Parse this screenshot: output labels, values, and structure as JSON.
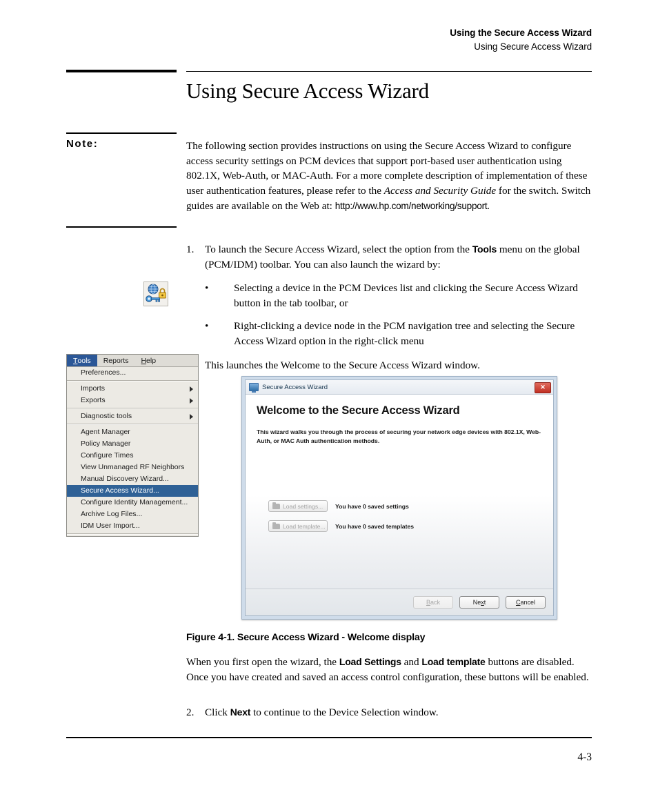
{
  "running_header": {
    "line1": "Using the Secure Access Wizard",
    "line2": "Using Secure Access Wizard"
  },
  "page_title": "Using Secure Access Wizard",
  "note": {
    "label": "Note:",
    "text_part1": "The following section provides instructions on using the Secure Access Wizard to configure access security settings on PCM devices that support port-based user authentication using 802.1X, Web-Auth, or MAC-Auth. For a more complete description of implementation of these user authentication features, please refer to the ",
    "italic_title": "Access and Security Guide",
    "text_part2": " for the switch. Switch guides are available on the Web at: ",
    "url": "http://www.hp.com/networking/support."
  },
  "steps": {
    "step1": {
      "number": "1.",
      "text_a": "To launch the Secure Access Wizard, select the option from the ",
      "bold_a": "Tools",
      "text_b": " menu on the global (PCM/IDM) toolbar. You can also launch the wizard by:",
      "bullets": [
        "Selecting a device in the PCM Devices list and clicking the Secure Access Wizard button in the tab toolbar, or",
        "Right-clicking a device node in the PCM navigation tree and selecting the Secure Access Wizard option in the right-click menu"
      ],
      "closing": "This launches the Welcome to the Secure Access Wizard window."
    },
    "step2": {
      "number": "2.",
      "text_a": "Click ",
      "bold_a": "Next",
      "text_b": " to continue to the Device Selection window."
    }
  },
  "margin_icon": "secure-access-wizard-toolbar-icon",
  "tools_menu": {
    "menubar": [
      {
        "label": "Tools",
        "mnemonic": "T",
        "active": true
      },
      {
        "label": "Reports",
        "mnemonic": "",
        "active": false
      },
      {
        "label": "Help",
        "mnemonic": "H",
        "active": false
      }
    ],
    "items": [
      {
        "label": "Preferences...",
        "submenu": false,
        "selected": false,
        "sep_after": true
      },
      {
        "label": "Imports",
        "submenu": true,
        "selected": false,
        "sep_after": false
      },
      {
        "label": "Exports",
        "submenu": true,
        "selected": false,
        "sep_after": true
      },
      {
        "label": "Diagnostic tools",
        "submenu": true,
        "selected": false,
        "sep_after": true
      },
      {
        "label": "Agent Manager",
        "submenu": false,
        "selected": false,
        "sep_after": false
      },
      {
        "label": "Policy Manager",
        "submenu": false,
        "selected": false,
        "sep_after": false
      },
      {
        "label": "Configure Times",
        "submenu": false,
        "selected": false,
        "sep_after": false
      },
      {
        "label": "View Unmanaged RF Neighbors",
        "submenu": false,
        "selected": false,
        "sep_after": false
      },
      {
        "label": "Manual Discovery Wizard...",
        "submenu": false,
        "selected": false,
        "sep_after": false
      },
      {
        "label": "Secure Access Wizard...",
        "submenu": false,
        "selected": true,
        "sep_after": false
      },
      {
        "label": "Configure Identity Management...",
        "submenu": false,
        "selected": false,
        "sep_after": false
      },
      {
        "label": "Archive Log Files...",
        "submenu": false,
        "selected": false,
        "sep_after": false
      },
      {
        "label": "IDM User Import...",
        "submenu": false,
        "selected": false,
        "sep_after": true
      }
    ],
    "selected_color": "#2f6196",
    "menubar_active_color": "#2b5797"
  },
  "wizard": {
    "titlebar_text": "Secure Access Wizard",
    "close_glyph": "✕",
    "heading": "Welcome to the Secure Access Wizard",
    "description": "This wizard walks you through the process of securing your network edge devices with 802.1X, Web-Auth, or MAC Auth authentication methods.",
    "load_rows": [
      {
        "button": "Load settings...",
        "status": "You have 0 saved settings",
        "disabled": true
      },
      {
        "button": "Load template...",
        "status": "You have 0 saved templates",
        "disabled": true
      }
    ],
    "footer_buttons": [
      {
        "label": "Back",
        "mnemonic": "B",
        "disabled": true
      },
      {
        "label": "Next",
        "mnemonic": "N",
        "disabled": false
      },
      {
        "label": "Cancel",
        "mnemonic": "C",
        "disabled": false
      }
    ]
  },
  "figure_caption": "Figure 4-1. Secure Access Wizard - Welcome display",
  "body_after_figure": {
    "text_a": "When you first open the wizard, the ",
    "bold_a": "Load Settings",
    "text_b": " and ",
    "bold_b": "Load template",
    "text_c": " buttons are disabled. Once you have created and saved an access control configuration, these buttons will be enabled."
  },
  "folio": "4-3"
}
